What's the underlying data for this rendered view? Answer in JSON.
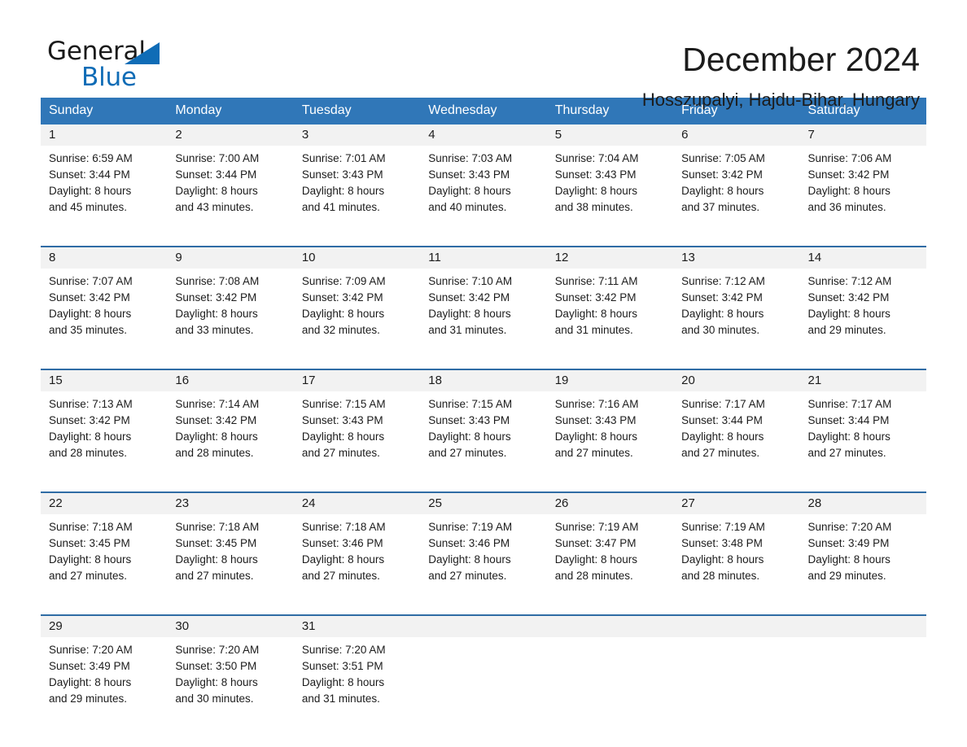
{
  "brand": {
    "name_part1": "General",
    "name_part2": "Blue",
    "triangle_color": "#0f6cb6"
  },
  "header": {
    "title": "December 2024",
    "subtitle": "Hosszupalyi, Hajdu-Bihar, Hungary"
  },
  "colors": {
    "header_blue": "#3077b8",
    "separator_blue": "#2f6ca5",
    "daynum_band": "#f2f2f2",
    "text": "#1c1c1c"
  },
  "weekday_headers": [
    "Sunday",
    "Monday",
    "Tuesday",
    "Wednesday",
    "Thursday",
    "Friday",
    "Saturday"
  ],
  "weeks": [
    {
      "days": [
        {
          "date": "1",
          "sunrise": "Sunrise: 6:59 AM",
          "sunset": "Sunset: 3:44 PM",
          "daylight_line1": "Daylight: 8 hours",
          "daylight_line2": "and 45 minutes."
        },
        {
          "date": "2",
          "sunrise": "Sunrise: 7:00 AM",
          "sunset": "Sunset: 3:44 PM",
          "daylight_line1": "Daylight: 8 hours",
          "daylight_line2": "and 43 minutes."
        },
        {
          "date": "3",
          "sunrise": "Sunrise: 7:01 AM",
          "sunset": "Sunset: 3:43 PM",
          "daylight_line1": "Daylight: 8 hours",
          "daylight_line2": "and 41 minutes."
        },
        {
          "date": "4",
          "sunrise": "Sunrise: 7:03 AM",
          "sunset": "Sunset: 3:43 PM",
          "daylight_line1": "Daylight: 8 hours",
          "daylight_line2": "and 40 minutes."
        },
        {
          "date": "5",
          "sunrise": "Sunrise: 7:04 AM",
          "sunset": "Sunset: 3:43 PM",
          "daylight_line1": "Daylight: 8 hours",
          "daylight_line2": "and 38 minutes."
        },
        {
          "date": "6",
          "sunrise": "Sunrise: 7:05 AM",
          "sunset": "Sunset: 3:42 PM",
          "daylight_line1": "Daylight: 8 hours",
          "daylight_line2": "and 37 minutes."
        },
        {
          "date": "7",
          "sunrise": "Sunrise: 7:06 AM",
          "sunset": "Sunset: 3:42 PM",
          "daylight_line1": "Daylight: 8 hours",
          "daylight_line2": "and 36 minutes."
        }
      ]
    },
    {
      "days": [
        {
          "date": "8",
          "sunrise": "Sunrise: 7:07 AM",
          "sunset": "Sunset: 3:42 PM",
          "daylight_line1": "Daylight: 8 hours",
          "daylight_line2": "and 35 minutes."
        },
        {
          "date": "9",
          "sunrise": "Sunrise: 7:08 AM",
          "sunset": "Sunset: 3:42 PM",
          "daylight_line1": "Daylight: 8 hours",
          "daylight_line2": "and 33 minutes."
        },
        {
          "date": "10",
          "sunrise": "Sunrise: 7:09 AM",
          "sunset": "Sunset: 3:42 PM",
          "daylight_line1": "Daylight: 8 hours",
          "daylight_line2": "and 32 minutes."
        },
        {
          "date": "11",
          "sunrise": "Sunrise: 7:10 AM",
          "sunset": "Sunset: 3:42 PM",
          "daylight_line1": "Daylight: 8 hours",
          "daylight_line2": "and 31 minutes."
        },
        {
          "date": "12",
          "sunrise": "Sunrise: 7:11 AM",
          "sunset": "Sunset: 3:42 PM",
          "daylight_line1": "Daylight: 8 hours",
          "daylight_line2": "and 31 minutes."
        },
        {
          "date": "13",
          "sunrise": "Sunrise: 7:12 AM",
          "sunset": "Sunset: 3:42 PM",
          "daylight_line1": "Daylight: 8 hours",
          "daylight_line2": "and 30 minutes."
        },
        {
          "date": "14",
          "sunrise": "Sunrise: 7:12 AM",
          "sunset": "Sunset: 3:42 PM",
          "daylight_line1": "Daylight: 8 hours",
          "daylight_line2": "and 29 minutes."
        }
      ]
    },
    {
      "days": [
        {
          "date": "15",
          "sunrise": "Sunrise: 7:13 AM",
          "sunset": "Sunset: 3:42 PM",
          "daylight_line1": "Daylight: 8 hours",
          "daylight_line2": "and 28 minutes."
        },
        {
          "date": "16",
          "sunrise": "Sunrise: 7:14 AM",
          "sunset": "Sunset: 3:42 PM",
          "daylight_line1": "Daylight: 8 hours",
          "daylight_line2": "and 28 minutes."
        },
        {
          "date": "17",
          "sunrise": "Sunrise: 7:15 AM",
          "sunset": "Sunset: 3:43 PM",
          "daylight_line1": "Daylight: 8 hours",
          "daylight_line2": "and 27 minutes."
        },
        {
          "date": "18",
          "sunrise": "Sunrise: 7:15 AM",
          "sunset": "Sunset: 3:43 PM",
          "daylight_line1": "Daylight: 8 hours",
          "daylight_line2": "and 27 minutes."
        },
        {
          "date": "19",
          "sunrise": "Sunrise: 7:16 AM",
          "sunset": "Sunset: 3:43 PM",
          "daylight_line1": "Daylight: 8 hours",
          "daylight_line2": "and 27 minutes."
        },
        {
          "date": "20",
          "sunrise": "Sunrise: 7:17 AM",
          "sunset": "Sunset: 3:44 PM",
          "daylight_line1": "Daylight: 8 hours",
          "daylight_line2": "and 27 minutes."
        },
        {
          "date": "21",
          "sunrise": "Sunrise: 7:17 AM",
          "sunset": "Sunset: 3:44 PM",
          "daylight_line1": "Daylight: 8 hours",
          "daylight_line2": "and 27 minutes."
        }
      ]
    },
    {
      "days": [
        {
          "date": "22",
          "sunrise": "Sunrise: 7:18 AM",
          "sunset": "Sunset: 3:45 PM",
          "daylight_line1": "Daylight: 8 hours",
          "daylight_line2": "and 27 minutes."
        },
        {
          "date": "23",
          "sunrise": "Sunrise: 7:18 AM",
          "sunset": "Sunset: 3:45 PM",
          "daylight_line1": "Daylight: 8 hours",
          "daylight_line2": "and 27 minutes."
        },
        {
          "date": "24",
          "sunrise": "Sunrise: 7:18 AM",
          "sunset": "Sunset: 3:46 PM",
          "daylight_line1": "Daylight: 8 hours",
          "daylight_line2": "and 27 minutes."
        },
        {
          "date": "25",
          "sunrise": "Sunrise: 7:19 AM",
          "sunset": "Sunset: 3:46 PM",
          "daylight_line1": "Daylight: 8 hours",
          "daylight_line2": "and 27 minutes."
        },
        {
          "date": "26",
          "sunrise": "Sunrise: 7:19 AM",
          "sunset": "Sunset: 3:47 PM",
          "daylight_line1": "Daylight: 8 hours",
          "daylight_line2": "and 28 minutes."
        },
        {
          "date": "27",
          "sunrise": "Sunrise: 7:19 AM",
          "sunset": "Sunset: 3:48 PM",
          "daylight_line1": "Daylight: 8 hours",
          "daylight_line2": "and 28 minutes."
        },
        {
          "date": "28",
          "sunrise": "Sunrise: 7:20 AM",
          "sunset": "Sunset: 3:49 PM",
          "daylight_line1": "Daylight: 8 hours",
          "daylight_line2": "and 29 minutes."
        }
      ]
    },
    {
      "days": [
        {
          "date": "29",
          "sunrise": "Sunrise: 7:20 AM",
          "sunset": "Sunset: 3:49 PM",
          "daylight_line1": "Daylight: 8 hours",
          "daylight_line2": "and 29 minutes."
        },
        {
          "date": "30",
          "sunrise": "Sunrise: 7:20 AM",
          "sunset": "Sunset: 3:50 PM",
          "daylight_line1": "Daylight: 8 hours",
          "daylight_line2": "and 30 minutes."
        },
        {
          "date": "31",
          "sunrise": "Sunrise: 7:20 AM",
          "sunset": "Sunset: 3:51 PM",
          "daylight_line1": "Daylight: 8 hours",
          "daylight_line2": "and 31 minutes."
        },
        {
          "date": "",
          "sunrise": "",
          "sunset": "",
          "daylight_line1": "",
          "daylight_line2": ""
        },
        {
          "date": "",
          "sunrise": "",
          "sunset": "",
          "daylight_line1": "",
          "daylight_line2": ""
        },
        {
          "date": "",
          "sunrise": "",
          "sunset": "",
          "daylight_line1": "",
          "daylight_line2": ""
        },
        {
          "date": "",
          "sunrise": "",
          "sunset": "",
          "daylight_line1": "",
          "daylight_line2": ""
        }
      ]
    }
  ]
}
